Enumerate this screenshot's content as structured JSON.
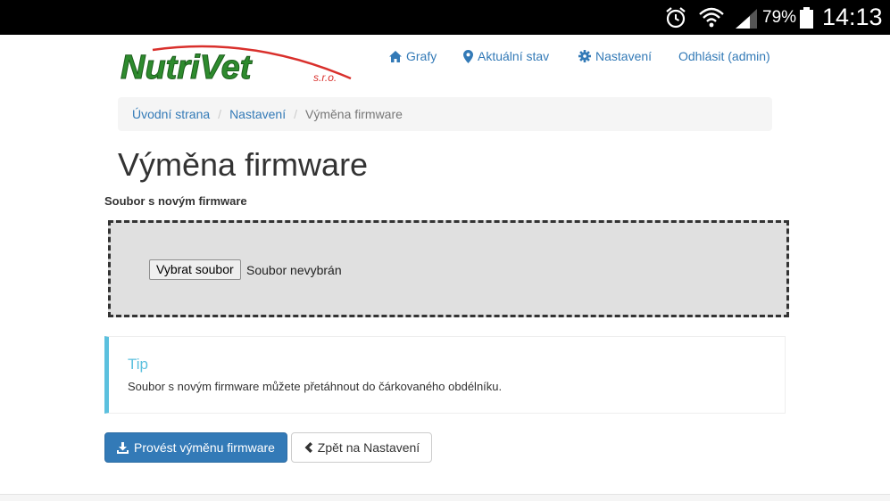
{
  "status_bar": {
    "battery_percent": "79%",
    "time": "14:13",
    "icons": [
      "alarm-icon",
      "wifi-icon",
      "signal-icon",
      "battery-icon"
    ]
  },
  "header": {
    "logo_text": "NutriVet",
    "logo_suffix": "s.r.o.",
    "nav": [
      {
        "label": "Grafy",
        "icon": "home-icon"
      },
      {
        "label": "Aktuální stav",
        "icon": "map-marker-icon"
      },
      {
        "label": "Nastavení",
        "icon": "gear-icon"
      },
      {
        "label": "Odhlásit (admin)"
      }
    ]
  },
  "breadcrumb": {
    "items": [
      "Úvodní strana",
      "Nastavení"
    ],
    "active": "Výměna firmware",
    "separator": "/"
  },
  "page": {
    "title": "Výměna firmware",
    "field_label": "Soubor s novým firmware",
    "file_button": "Vybrat soubor",
    "file_status": "Soubor nevybrán"
  },
  "tip": {
    "title": "Tip",
    "text": "Soubor s novým firmware můžete přetáhnout do čárkovaného obdélníku."
  },
  "actions": {
    "primary": "Provést výměnu firmware",
    "primary_icon": "download-icon",
    "secondary": "Zpět na Nastavení",
    "secondary_icon": "chevron-left-icon"
  },
  "colors": {
    "link": "#337ab7",
    "primary_button": "#337ab7",
    "tip_accent": "#5bc0de",
    "logo_green": "#2e8b2e",
    "logo_red": "#d9302c"
  }
}
